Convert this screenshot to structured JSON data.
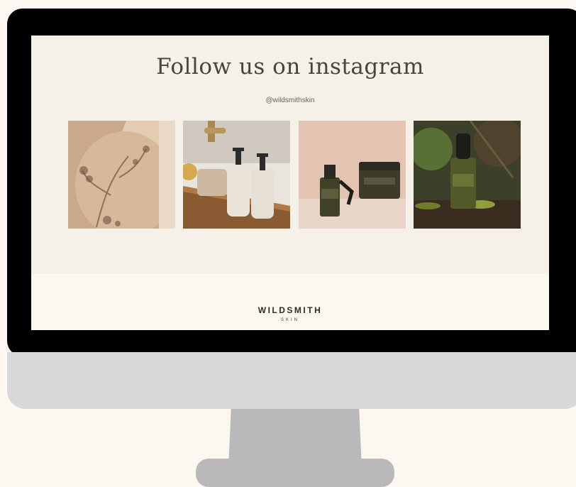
{
  "instagram_section": {
    "heading": "Follow us on instagram",
    "handle": "@wildsmithskin",
    "photos": [
      {
        "icon": "botanical-shadow-back-photo-icon"
      },
      {
        "icon": "bath-tray-bottles-photo-icon"
      },
      {
        "icon": "serum-and-balm-jar-photo-icon"
      },
      {
        "icon": "serum-on-mossy-log-photo-icon"
      }
    ]
  },
  "footer": {
    "brand_name": "WILDSMITH",
    "brand_subtitle": "SKIN"
  },
  "colors": {
    "page_background": "#fcf7f1",
    "screen_background": "#f5f1e8",
    "heading_text": "#4a4438",
    "bezel": "#000000",
    "chin": "#d8d8d8",
    "stand": "#b9b9b9"
  }
}
